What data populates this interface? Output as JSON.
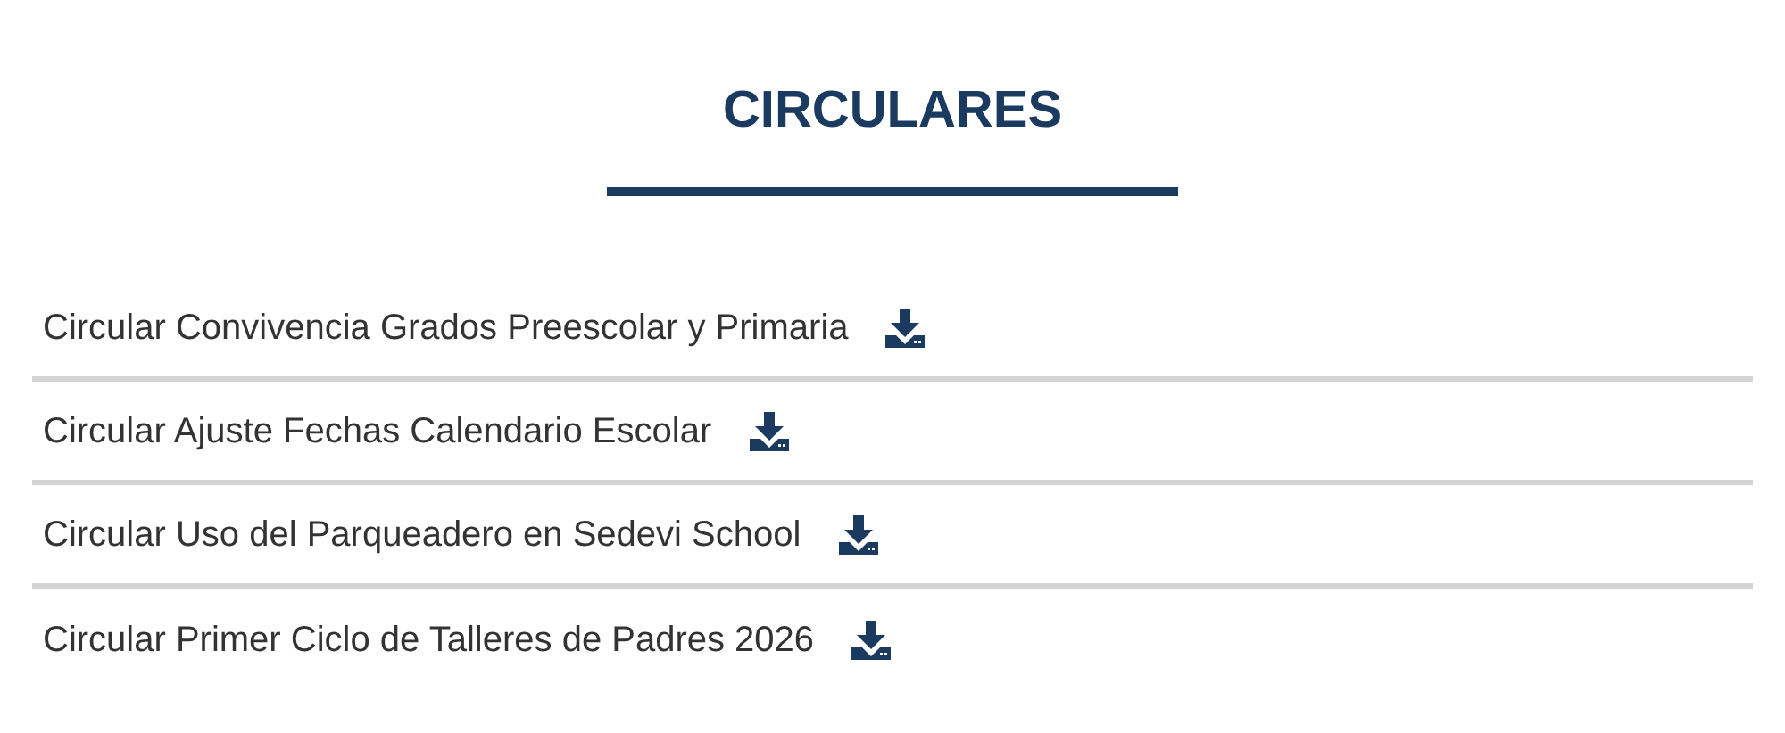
{
  "title": "CIRCULARES",
  "items": [
    {
      "label": "Circular Convivencia Grados Preescolar y Primaria"
    },
    {
      "label": "Circular Ajuste Fechas Calendario Escolar"
    },
    {
      "label": "Circular Uso del Parqueadero en Sedevi School"
    },
    {
      "label": "Circular Primer Ciclo de Talleres de Padres 2026"
    }
  ]
}
